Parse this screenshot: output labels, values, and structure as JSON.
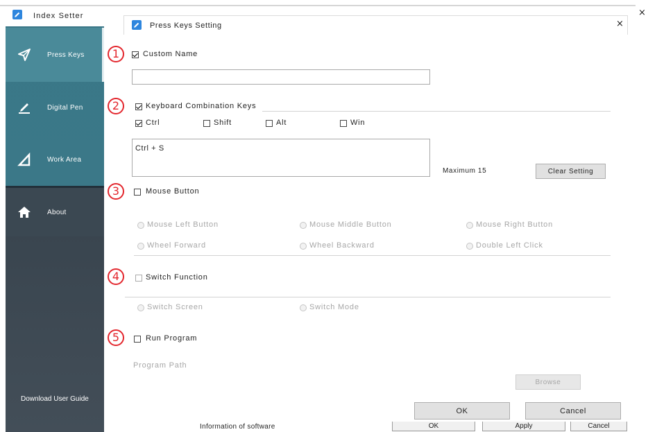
{
  "colors": {
    "sidebar_teal": "#3a7787",
    "sidebar_slate": "#434e58",
    "marker_red": "#e3262d",
    "app_icon_blue": "#2e86de"
  },
  "window": {
    "icon": "app-pen-icon",
    "title": "Index Setter",
    "close": "×"
  },
  "sidebar": {
    "items": [
      {
        "label": "Press Keys",
        "icon": "send-icon",
        "selected": true
      },
      {
        "label": "Digital Pen",
        "icon": "pen-icon",
        "selected": false
      },
      {
        "label": "Work Area",
        "icon": "ruler-icon",
        "selected": false
      },
      {
        "label": "About",
        "icon": "home-icon",
        "selected": false
      }
    ],
    "footer_link": "Download User Guide"
  },
  "dialog": {
    "icon": "app-pen-icon",
    "title": "Press Keys Setting",
    "close": "×",
    "markers": [
      "1",
      "2",
      "3",
      "4",
      "5"
    ],
    "custom_name": {
      "label": "Custom Name",
      "checked": true
    },
    "keyboard": {
      "label": "Keyboard Combination Keys",
      "checked": true,
      "modifiers": [
        {
          "label": "Ctrl",
          "checked": true
        },
        {
          "label": "Shift",
          "checked": false
        },
        {
          "label": "Alt",
          "checked": false
        },
        {
          "label": "Win",
          "checked": false
        }
      ],
      "combo": "Ctrl + S",
      "max_note": "Maximum 15",
      "clear_button": "Clear Setting"
    },
    "mouse_button": {
      "label": "Mouse Button",
      "checked": false,
      "options": [
        "Mouse Left Button",
        "Mouse Middle Button",
        "Mouse Right Button",
        "Wheel Forward",
        "Wheel Backward",
        "Double Left Click"
      ]
    },
    "switch_function": {
      "label": "Switch Function",
      "checked": false,
      "options": [
        "Switch Screen",
        "Switch Mode"
      ]
    },
    "run_program": {
      "label": "Run Program",
      "checked": false,
      "path_label": "Program Path",
      "browse_button": "Browse"
    },
    "ok_button": "OK",
    "cancel_button": "Cancel"
  },
  "main_footer": {
    "info_link": "Information of software",
    "ok_button": "OK",
    "apply_button": "Apply",
    "cancel_button": "Cancel"
  }
}
